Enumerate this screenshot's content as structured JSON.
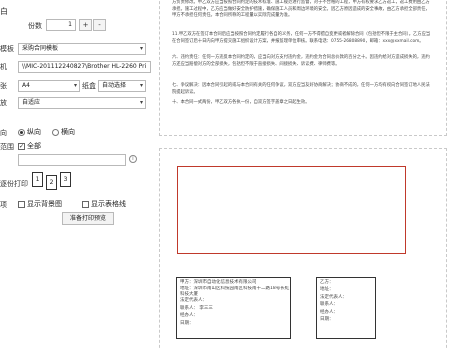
{
  "panel": {
    "top_glyph": "白",
    "copies": {
      "label": "份数",
      "value": "1",
      "plus": "+",
      "minus": "-"
    },
    "template": {
      "label": "模板",
      "value": "采购合同模板"
    },
    "printer": {
      "label": "机",
      "value": "\\\\MIC-201112240827\\Brother HL-2260 Pri"
    },
    "paper": {
      "label": "张",
      "value": "A4",
      "tray_label": "纸盒",
      "tray_value": "自动选择"
    },
    "scale": {
      "label": "放",
      "value": "自适应"
    },
    "orientation": {
      "label": "向",
      "portrait": "纵向",
      "landscape": "横向"
    },
    "range": {
      "label": "范围",
      "all_label": "全部",
      "pages_placeholder": ""
    },
    "collate": {
      "label": "逐份打印",
      "page_nums": [
        "1",
        "2",
        "3"
      ]
    },
    "options": {
      "label": "项",
      "show_bg": "显示背景图",
      "show_table": "显示表格线"
    },
    "print_button": "准备打印预览"
  },
  "doc": {
    "paragraphs": [
      "方负责修改。甲乙双方应当按照合同约定的技术标准、施工规范进行监督，对于不合格的工程，甲方有权要求乙方返工，返工费用由乙方承担。施工过程中，乙方应当做好安全防护措施，确保施工人员和周边环境的安全。因乙方原因造成的安全事故，由乙方承担全部责任，甲方不承担任何责任。本合同所称的工程量以实际完成量为准。",
      "11.甲乙双方在签订本合同后应当按照合同约定履行各自的义务，任何一方不得擅自变更或者解除合同（包括但不限于主合同）。乙方应当在合同签订后十日内向甲方提交施工组织设计方案，并报监理单位审核。联系电话：0755-26808890，邮箱：xxx@xxmail.com。",
      "六、违约责任：任何一方违反本合同约定的，应当向对方支付违约金，违约金为合同总价款的百分之十。因违约给对方造成损失的，违约方还应当赔偿对方的全部损失，包括但不限于直接损失、间接损失、诉讼费、律师费等。",
      "七、争议解决：因本合同引起的或与本合同有关的任何争议，双方应当友好协商解决；协商不成的，任何一方均有权向合同签订地人民法院提起诉讼。",
      "十、本合同一式两份，甲乙双方各执一份，自双方签字盖章之日起生效。"
    ],
    "party_a": [
      "甲方：深圳市自动化信息技术有限公司",
      "地址：深圳市南山区科技园南区科技南十二路18号长虹科技大厦",
      "法定代表人：",
      "联系人：     李三三",
      "经办人：",
      "日期："
    ],
    "party_b": [
      "乙方：",
      "地址：",
      "法定代表人：",
      "联系人：",
      "经办人：",
      "日期："
    ]
  },
  "colors": {
    "accent_red": "#c0392b",
    "border": "#b9b9b9"
  }
}
